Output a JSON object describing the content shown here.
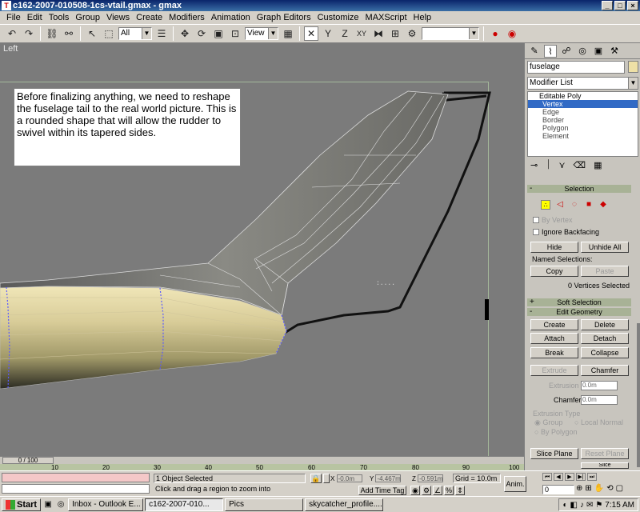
{
  "window": {
    "title": "c162-2007-010508-1cs-vtail.gmax - gmax",
    "min": "_",
    "max": "□",
    "close": "×"
  },
  "menu": [
    "File",
    "Edit",
    "Tools",
    "Group",
    "Views",
    "Create",
    "Modifiers",
    "Animation",
    "Graph Editors",
    "Customize",
    "MAXScript",
    "Help"
  ],
  "toolbar": {
    "filter_value": "All",
    "refcoord_value": "View",
    "named_sel_value": ""
  },
  "viewport": {
    "label": "Left",
    "note": "Before finalizing anything, we need to reshape the fuselage tail to the real world picture.  This is a rounded shape that will allow the rudder to swivel within its tapered sides.",
    "fuselage_color": "#e8dcac",
    "edge_color": "#4646ff"
  },
  "command_panel": {
    "object_name": "fuselage",
    "object_color": "#eee0a6",
    "modifier_list": "Modifier List",
    "stack": {
      "top": "Editable Poly",
      "items": [
        "Vertex",
        "Edge",
        "Border",
        "Polygon",
        "Element"
      ],
      "selected": "Vertex"
    },
    "selection": {
      "title": "Selection",
      "by_vertex": "By Vertex",
      "ignore_backfacing": "Ignore Backfacing",
      "hide": "Hide",
      "unhide_all": "Unhide All",
      "named_selections": "Named Selections:",
      "copy": "Copy",
      "paste": "Paste",
      "status": "0 Vertices Selected"
    },
    "soft_selection": {
      "title": "Soft Selection",
      "sign": "+"
    },
    "edit_geometry": {
      "title": "Edit Geometry",
      "sign": "-",
      "create": "Create",
      "delete": "Delete",
      "attach": "Attach",
      "detach": "Detach",
      "break": "Break",
      "collapse": "Collapse",
      "extrude": "Extrude",
      "chamfer_btn": "Chamfer",
      "extrusion_label": "Extrusion",
      "extrusion_value": "0.0m",
      "chamfer_label": "Chamfer",
      "chamfer_value": "0.0m",
      "extrusion_type": "Extrusion Type",
      "group": "Group",
      "local_normal": "Local Normal",
      "by_polygon": "By Polygon",
      "slice_plane": "Slice Plane",
      "reset_plane": "Reset Plane",
      "slice": "Slice"
    }
  },
  "timeline": {
    "slider": "0 / 100",
    "ticks": [
      "10",
      "20",
      "30",
      "40",
      "50",
      "60",
      "70",
      "80",
      "90",
      "100"
    ]
  },
  "status": {
    "selected": "1 Object Selected",
    "prompt": "Click and drag a region to zoom into",
    "x_label": "X",
    "x": "-0.0m",
    "y_label": "Y",
    "y": "-4.467m",
    "z_label": "Z",
    "z": "-0.591m",
    "grid": "Grid = 10.0m",
    "add_time_tag": "Add Time Tag",
    "anim": "Anim.",
    "frame": "0"
  },
  "taskbar": {
    "start": "Start",
    "tasks": [
      "Inbox - Outlook E...",
      "c162-2007-010...",
      "Pics",
      "skycatcher_profile...."
    ],
    "active": "c162-2007-010...",
    "clock": "7:15 AM"
  }
}
